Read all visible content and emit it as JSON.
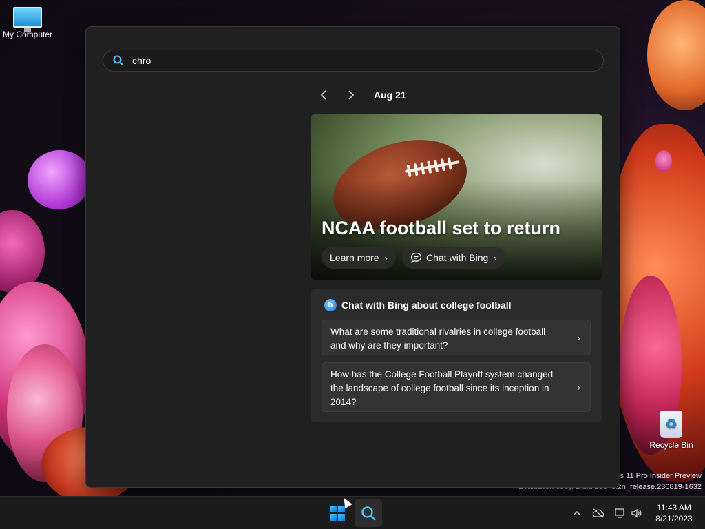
{
  "desktop": {
    "icons": {
      "my_computer": "My Computer",
      "recycle_bin": "Recycle Bin"
    },
    "watermark": {
      "line1": "s 11 Pro Insider Preview",
      "line2": "Evaluation copy. Build 23575.zn_release.230819-1632"
    }
  },
  "search": {
    "query": "chro",
    "date_nav": {
      "prev_icon": "chevron-left-icon",
      "next_icon": "chevron-right-icon",
      "date": "Aug 21"
    },
    "hero": {
      "title": "NCAA football set to return",
      "learn_more": "Learn more",
      "chat_with_bing": "Chat with Bing"
    },
    "chat_card": {
      "heading": "Chat with Bing about college football",
      "questions": [
        "What are some traditional rivalries in college football and why are they important?",
        "How has the College Football Playoff system changed the landscape of college football since its inception in 2014?"
      ]
    }
  },
  "taskbar": {
    "time": "11:43 AM",
    "date": "8/21/2023"
  },
  "colors": {
    "panel_bg": "#202020",
    "accent": "#1b6fd8",
    "taskbar_bg": "#1c1c1c"
  }
}
